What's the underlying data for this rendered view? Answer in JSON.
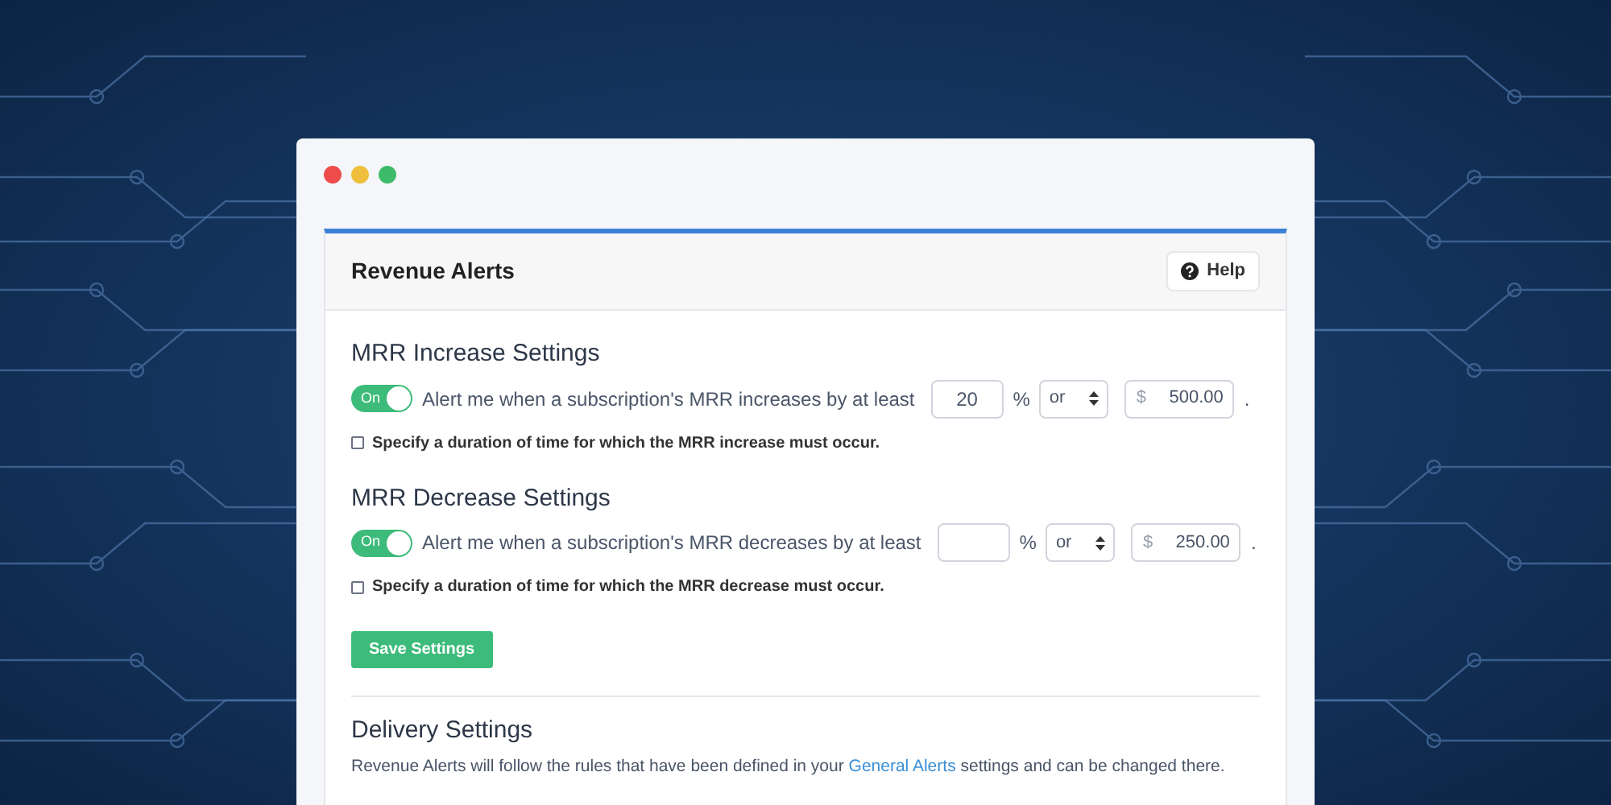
{
  "window": {
    "controls": [
      {
        "color": "#ee4b4b"
      },
      {
        "color": "#eebf3c"
      },
      {
        "color": "#3dbb6a"
      }
    ]
  },
  "card": {
    "title": "Revenue Alerts",
    "help_button": "Help"
  },
  "sections": [
    {
      "heading": "MRR Increase Settings",
      "toggle": {
        "label": "On",
        "on": true
      },
      "sentence": "Alert me when a subscription's MRR increases by at least",
      "percent": {
        "value": "20",
        "unit": "%"
      },
      "operator": "or",
      "amount": {
        "currency": "$",
        "value": "500.00"
      },
      "end": ".",
      "duration": {
        "label": "Specify a duration of time for which the MRR increase must occur.",
        "checked": false
      }
    },
    {
      "heading": "MRR Decrease Settings",
      "toggle": {
        "label": "On",
        "on": true
      },
      "sentence": "Alert me when a subscription's MRR decreases by at least",
      "percent": {
        "unit": "%"
      },
      "operator": "or",
      "amount": {
        "currency": "$",
        "value": "250.00"
      },
      "end": ".",
      "duration": {
        "label": "Specify a duration of time for which the MRR decrease must occur.",
        "checked": false
      }
    }
  ],
  "save_button": "Save Settings",
  "delivery": {
    "heading": "Delivery Settings",
    "text_before": "Revenue Alerts will follow the rules that have been defined in your",
    "link": "General Alerts",
    "text_after": "settings and can be changed there."
  }
}
